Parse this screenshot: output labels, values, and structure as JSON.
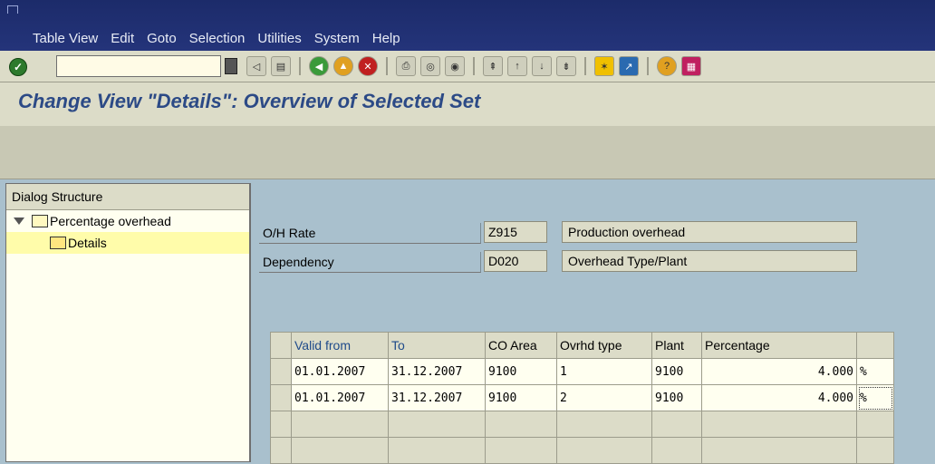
{
  "menu": [
    "Table View",
    "Edit",
    "Goto",
    "Selection",
    "Utilities",
    "System",
    "Help"
  ],
  "toolbar": {
    "icons": [
      "back-arrow-icon",
      "save-icon",
      "back-icon",
      "exit-icon",
      "cancel-icon",
      "print-icon",
      "find-icon",
      "find-next-icon",
      "first-page-icon",
      "previous-page-icon",
      "next-page-icon",
      "last-page-icon",
      "create-session-icon",
      "shortcut-icon",
      "help-icon",
      "layout-icon"
    ]
  },
  "title": "Change View \"Details\": Overview of Selected Set",
  "dialog": {
    "heading": "Dialog Structure",
    "items": [
      {
        "label": "Percentage overhead",
        "expanded": true
      },
      {
        "label": "Details",
        "selected": true
      }
    ]
  },
  "header": {
    "oh_rate_label": "O/H Rate",
    "oh_rate_value": "Z915",
    "oh_rate_desc": "Production overhead",
    "dependency_label": "Dependency",
    "dependency_value": "D020",
    "dependency_desc": "Overhead Type/Plant"
  },
  "table": {
    "columns": [
      "Valid from",
      "To",
      "CO Area",
      "Ovrhd type",
      "Plant",
      "Percentage"
    ],
    "rows": [
      {
        "valid_from": "01.01.2007",
        "to": "31.12.2007",
        "co_area": "9100",
        "ovrhd_type": "1",
        "plant": "9100",
        "percentage": "4.000",
        "unit": "%"
      },
      {
        "valid_from": "01.01.2007",
        "to": "31.12.2007",
        "co_area": "9100",
        "ovrhd_type": "2",
        "plant": "9100",
        "percentage": "4.000",
        "unit": "%"
      }
    ]
  }
}
